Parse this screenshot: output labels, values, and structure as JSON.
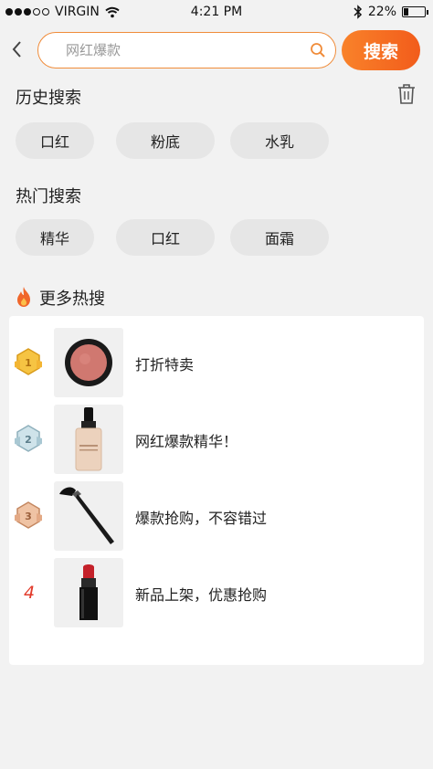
{
  "status_bar": {
    "carrier": "VIRGIN",
    "time": "4:21 PM",
    "battery": "22%",
    "battery_level": 0.22
  },
  "search": {
    "placeholder": "网红爆款",
    "button_label": "搜索"
  },
  "history": {
    "title": "历史搜索",
    "tags": [
      "口红",
      "粉底",
      "水乳"
    ]
  },
  "hot": {
    "title": "热门搜索",
    "tags": [
      "精华",
      "口红",
      "面霜"
    ]
  },
  "more_hot": {
    "title": "更多热搜",
    "items": [
      {
        "rank": "1",
        "label": "打折特卖",
        "product": "blush-compact"
      },
      {
        "rank": "2",
        "label": "网红爆款精华！",
        "product": "liquid-foundation"
      },
      {
        "rank": "3",
        "label": "爆款抢购，不容错过",
        "product": "makeup-brush"
      },
      {
        "rank": "4",
        "label": "新品上架，优惠抢购",
        "product": "lipstick"
      }
    ]
  },
  "colors": {
    "accent": "#f9822a",
    "accent_dark": "#f25c1b",
    "rank_red": "#e23a2a",
    "background": "#f2f2f2"
  }
}
